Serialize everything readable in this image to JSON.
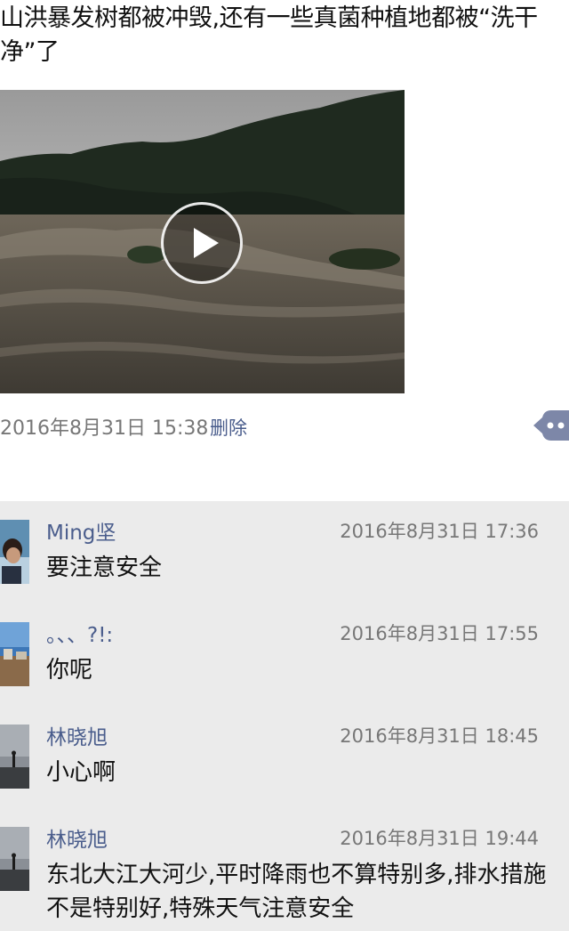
{
  "post": {
    "text": "山洪暴发树都被冲毁,还有一些真菌种植地都被“洗干净”了",
    "timestamp": "2016年8月31日 15:38",
    "delete_label": "删除",
    "video_icon": "play-icon",
    "more_icon": "more-dots-icon"
  },
  "comments": [
    {
      "author": "Ming坚",
      "time": "2016年8月31日 17:36",
      "text": "要注意安全"
    },
    {
      "author": "。、、?!:",
      "time": "2016年8月31日 17:55",
      "text": "你呢"
    },
    {
      "author": "林晓旭",
      "time": "2016年8月31日 18:45",
      "text": "小心啊"
    },
    {
      "author": "林晓旭",
      "time": "2016年8月31日 19:44",
      "text": "东北大江大河少,平时降雨也不算特别多,排水措施不是特别好,特殊天气注意安全"
    }
  ],
  "colors": {
    "link": "#4a5d8c",
    "meta": "#777777",
    "comment_bg": "#ebebeb"
  }
}
